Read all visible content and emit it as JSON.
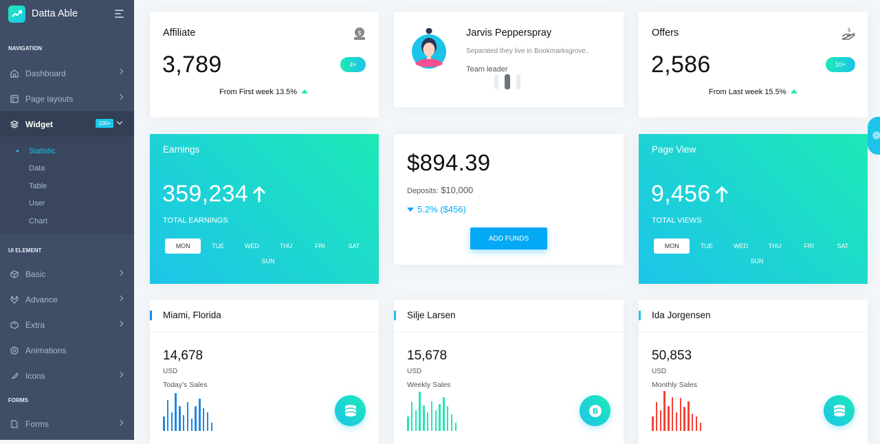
{
  "brand": {
    "name": "Datta Able",
    "icon": "trending-up-icon"
  },
  "sidebar": {
    "sections": {
      "navigation": "NAVIGATION",
      "ui_element": "UI ELEMENT",
      "forms": "FORMS"
    },
    "nav": [
      {
        "label": "Dashboard",
        "icon": "home-icon"
      },
      {
        "label": "Page layouts",
        "icon": "layout-icon"
      },
      {
        "label": "Widget",
        "icon": "layers-icon",
        "badge": "100+"
      }
    ],
    "submenu": [
      "Statistic",
      "Data",
      "Table",
      "User",
      "Chart"
    ],
    "ui": [
      {
        "label": "Basic",
        "icon": "box-icon"
      },
      {
        "label": "Advance",
        "icon": "gitlab-icon"
      },
      {
        "label": "Extra",
        "icon": "package-icon"
      },
      {
        "label": "Animations",
        "icon": "aperture-icon"
      },
      {
        "label": "Icons",
        "icon": "feather-icon"
      }
    ],
    "forms": [
      {
        "label": "Forms",
        "icon": "file-text-icon"
      }
    ]
  },
  "affiliate": {
    "title": "Affiliate",
    "value": "3,789",
    "pill": "4+",
    "note": "From First week 13.5%"
  },
  "profile": {
    "name": "Jarvis Pepperspray",
    "desc": "Separated they live in Bookmarksgrove..",
    "role": "Team leader"
  },
  "offers": {
    "title": "Offers",
    "value": "2,586",
    "pill": "10+",
    "note": "From Last week 15.5%"
  },
  "earnings": {
    "title": "Earnings",
    "value": "359,234",
    "label": "TOTAL EARNINGS",
    "days": [
      "MON",
      "TUE",
      "WED",
      "THU",
      "FRI",
      "SAT",
      "SUN"
    ]
  },
  "funds": {
    "amount": "$894.39",
    "deposits_label": "Deposits:",
    "deposits_value": "$10,000",
    "change": "5.2% ($456)",
    "button": "ADD FUNDS"
  },
  "pageview": {
    "title": "Page View",
    "value": "9,456",
    "label": "TOTAL VIEWS",
    "days": [
      "MON",
      "TUE",
      "WED",
      "THU",
      "FRI",
      "SAT",
      "SUN"
    ]
  },
  "stats": [
    {
      "name": "Miami, Florida",
      "value": "14,678",
      "unit": "USD",
      "label": "Today's Sales",
      "color": "#1e88e5",
      "icon": "coins-icon",
      "bars": [
        0.35,
        0.75,
        0.45,
        0.92,
        0.6,
        0.38,
        0.7,
        0.3,
        0.6,
        0.78,
        0.55,
        0.45,
        0.2
      ]
    },
    {
      "name": "Silje Larsen",
      "value": "15,678",
      "unit": "USD",
      "label": "Weekly Sales",
      "color": "#1de9b6",
      "icon": "bitcoin-icon",
      "bars": [
        0.35,
        0.7,
        0.5,
        0.95,
        0.62,
        0.45,
        0.72,
        0.5,
        0.65,
        0.82,
        0.6,
        0.4,
        0.2
      ]
    },
    {
      "name": "Ida Jorgensen",
      "value": "50,853",
      "unit": "USD",
      "label": "Monthly Sales",
      "color": "#f44236",
      "icon": "coins-icon",
      "bars": [
        0.35,
        0.7,
        0.5,
        0.97,
        0.6,
        0.82,
        0.45,
        0.8,
        0.58,
        0.72,
        0.42,
        0.35,
        0.2
      ]
    }
  ]
}
